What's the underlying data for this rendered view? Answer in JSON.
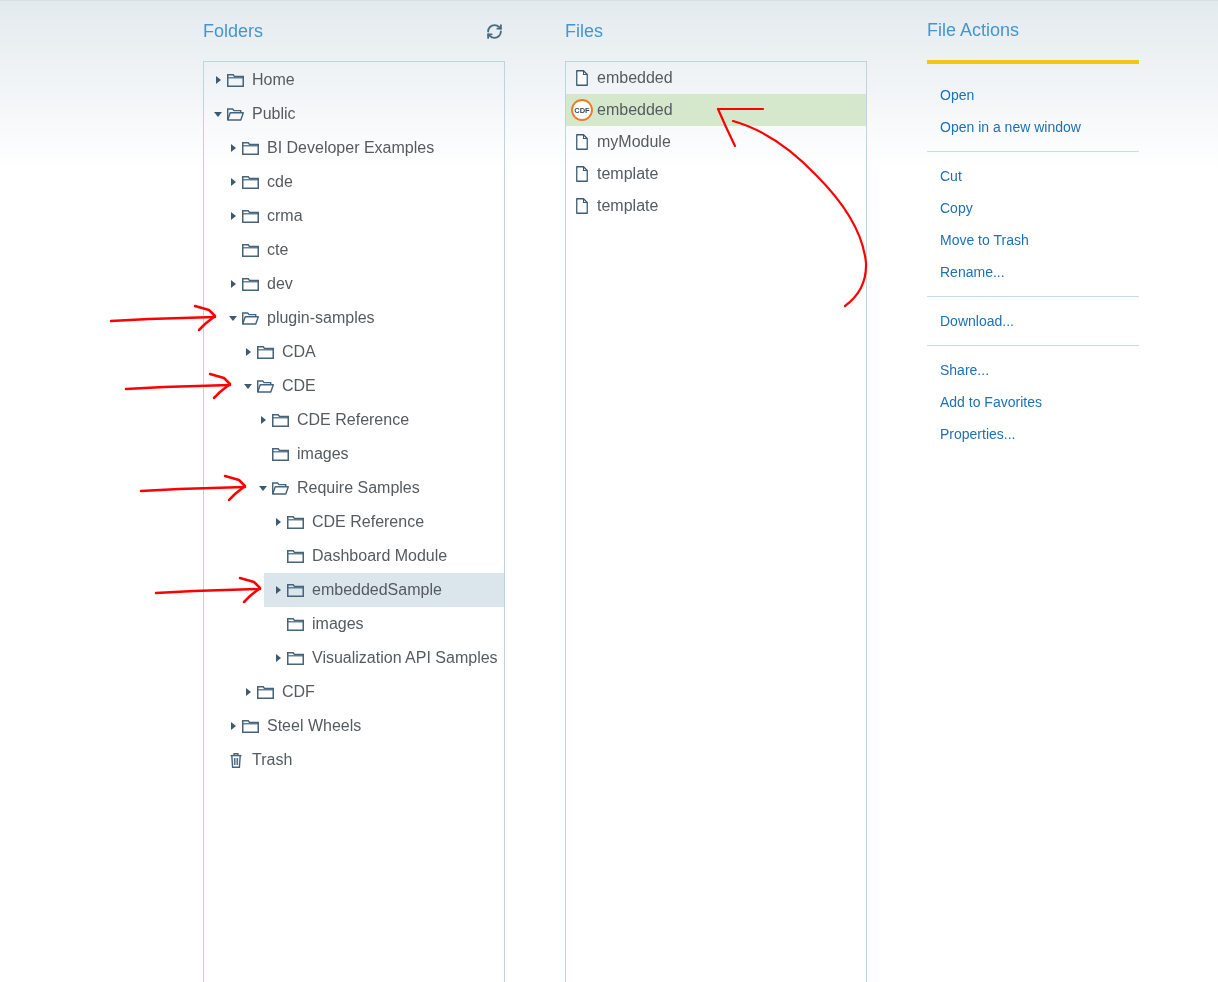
{
  "folders": {
    "title": "Folders",
    "tree": [
      {
        "label": "Home",
        "kind": "folder",
        "expandable": true,
        "expanded": false,
        "selected": false,
        "annotated": false
      },
      {
        "label": "Public",
        "kind": "folder",
        "expandable": true,
        "expanded": true,
        "selected": false,
        "annotated": false,
        "children": [
          {
            "label": "BI Developer Examples",
            "kind": "folder",
            "expandable": true,
            "expanded": false,
            "selected": false,
            "annotated": false
          },
          {
            "label": "cde",
            "kind": "folder",
            "expandable": true,
            "expanded": false,
            "selected": false,
            "annotated": false
          },
          {
            "label": "crma",
            "kind": "folder",
            "expandable": true,
            "expanded": false,
            "selected": false,
            "annotated": false
          },
          {
            "label": "cte",
            "kind": "folder",
            "expandable": false,
            "expanded": false,
            "selected": false,
            "annotated": false
          },
          {
            "label": "dev",
            "kind": "folder",
            "expandable": true,
            "expanded": false,
            "selected": false,
            "annotated": false
          },
          {
            "label": "plugin-samples",
            "kind": "folder",
            "expandable": true,
            "expanded": true,
            "selected": false,
            "annotated": true,
            "children": [
              {
                "label": "CDA",
                "kind": "folder",
                "expandable": true,
                "expanded": false,
                "selected": false,
                "annotated": false
              },
              {
                "label": "CDE",
                "kind": "folder",
                "expandable": true,
                "expanded": true,
                "selected": false,
                "annotated": true,
                "children": [
                  {
                    "label": "CDE Reference",
                    "kind": "folder",
                    "expandable": true,
                    "expanded": false,
                    "selected": false,
                    "annotated": false
                  },
                  {
                    "label": "images",
                    "kind": "folder",
                    "expandable": false,
                    "expanded": false,
                    "selected": false,
                    "annotated": false
                  },
                  {
                    "label": "Require Samples",
                    "kind": "folder",
                    "expandable": true,
                    "expanded": true,
                    "selected": false,
                    "annotated": true,
                    "children": [
                      {
                        "label": "CDE Reference",
                        "kind": "folder",
                        "expandable": true,
                        "expanded": false,
                        "selected": false,
                        "annotated": false
                      },
                      {
                        "label": "Dashboard Module",
                        "kind": "folder",
                        "expandable": false,
                        "expanded": false,
                        "selected": false,
                        "annotated": false
                      },
                      {
                        "label": "embeddedSample",
                        "kind": "folder",
                        "expandable": true,
                        "expanded": false,
                        "selected": true,
                        "annotated": true
                      },
                      {
                        "label": "images",
                        "kind": "folder",
                        "expandable": false,
                        "expanded": false,
                        "selected": false,
                        "annotated": false
                      },
                      {
                        "label": "Visualization API Samples",
                        "kind": "folder",
                        "expandable": true,
                        "expanded": false,
                        "selected": false,
                        "annotated": false
                      }
                    ]
                  }
                ]
              },
              {
                "label": "CDF",
                "kind": "folder",
                "expandable": true,
                "expanded": false,
                "selected": false,
                "annotated": false
              }
            ]
          },
          {
            "label": "Steel Wheels",
            "kind": "folder",
            "expandable": true,
            "expanded": false,
            "selected": false,
            "annotated": false
          }
        ]
      },
      {
        "label": "Trash",
        "kind": "trash",
        "selected": false,
        "annotated": false
      }
    ]
  },
  "files": {
    "title": "Files",
    "items": [
      {
        "name": "embedded",
        "kind": "file",
        "selected": false,
        "annotated": false
      },
      {
        "name": "embedded",
        "kind": "cdf",
        "badge": "CDF",
        "selected": true,
        "annotated": true
      },
      {
        "name": "myModule",
        "kind": "file",
        "selected": false,
        "annotated": false
      },
      {
        "name": "template",
        "kind": "file",
        "selected": false,
        "annotated": false
      },
      {
        "name": "template",
        "kind": "file",
        "selected": false,
        "annotated": false
      }
    ]
  },
  "file_actions": {
    "title": "File Actions",
    "groups": [
      [
        "Open",
        "Open in a new window"
      ],
      [
        "Cut",
        "Copy",
        "Move to Trash",
        "Rename..."
      ],
      [
        "Download..."
      ],
      [
        "Share...",
        "Add to Favorites",
        "Properties..."
      ]
    ]
  }
}
